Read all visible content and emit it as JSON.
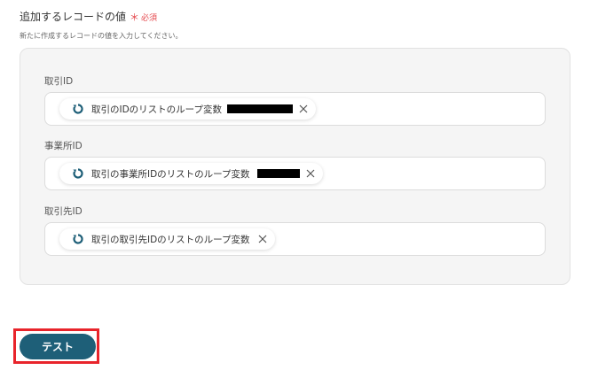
{
  "section": {
    "title": "追加するレコードの値",
    "required_mark": "＊",
    "required_label": "必須",
    "description": "新たに作成するレコードの値を入力してください。"
  },
  "fields": [
    {
      "label": "取引ID",
      "chip_text": "取引のIDのリストのループ変数",
      "redacted": true
    },
    {
      "label": "事業所ID",
      "chip_text": "取引の事業所IDのリストのループ変数",
      "redacted": true
    },
    {
      "label": "取引先ID",
      "chip_text": "取引の取引先IDのリストのループ変数",
      "redacted": false
    }
  ],
  "actions": {
    "test_label": "テスト"
  },
  "colors": {
    "accent": "#1e5f78",
    "required": "#e5484d",
    "highlight": "#e8242b"
  },
  "icons": {
    "chip": "loop-icon",
    "remove": "close-icon"
  }
}
